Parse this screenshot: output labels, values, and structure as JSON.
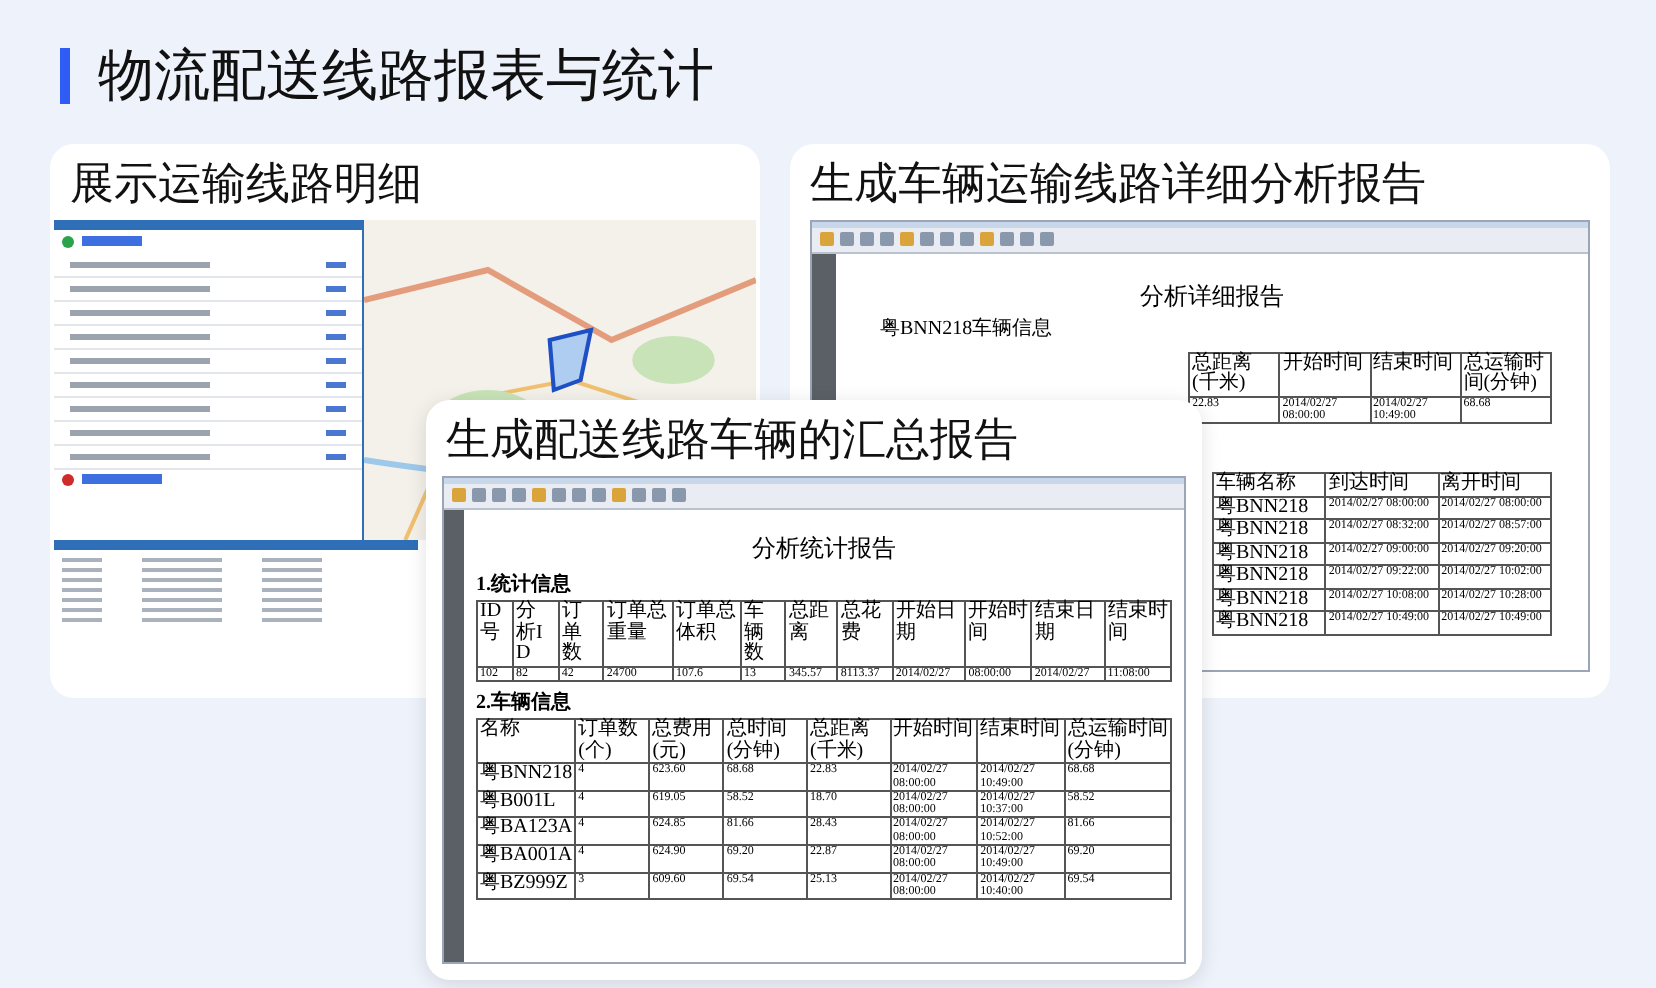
{
  "page_title": "物流配送线路报表与统计",
  "cards": [
    {
      "title": "展示运输线路明细",
      "kind": "map"
    },
    {
      "title": "生成车辆运输线路详细分析报告",
      "kind": "detail"
    },
    {
      "title": "生成配送线路车辆的汇总报告",
      "kind": "summary"
    }
  ],
  "detail_report": {
    "title": "分析详细报告",
    "subtitle": "粤BNN218车辆信息",
    "table_1": {
      "columns": [
        "总距离(千米)",
        "开始时间",
        "结束时间",
        "总运输时间(分钟)"
      ],
      "rows": [
        [
          "22.83",
          "2014/02/27 08:00:00",
          "2014/02/27 10:49:00",
          "68.68"
        ]
      ]
    },
    "table_2": {
      "columns": [
        "车辆名称",
        "到达时间",
        "离开时间"
      ],
      "rows": [
        [
          "粤BNN218",
          "2014/02/27 08:00:00",
          "2014/02/27 08:00:00"
        ],
        [
          "粤BNN218",
          "2014/02/27 08:32:00",
          "2014/02/27 08:57:00"
        ],
        [
          "粤BNN218",
          "2014/02/27 09:00:00",
          "2014/02/27 09:20:00"
        ],
        [
          "粤BNN218",
          "2014/02/27 09:22:00",
          "2014/02/27 10:02:00"
        ],
        [
          "粤BNN218",
          "2014/02/27 10:08:00",
          "2014/02/27 10:28:00"
        ],
        [
          "粤BNN218",
          "2014/02/27 10:49:00",
          "2014/02/27 10:49:00"
        ]
      ]
    }
  },
  "summary_report": {
    "title": "分析统计报告",
    "sections": [
      {
        "heading": "1.统计信息",
        "columns": [
          "ID号",
          "分析ID",
          "订单数",
          "订单总重量",
          "订单总体积",
          "车辆数",
          "总距离",
          "总花费",
          "开始日期",
          "开始时间",
          "结束日期",
          "结束时间"
        ],
        "rows": [
          [
            "102",
            "82",
            "42",
            "24700",
            "107.6",
            "13",
            "345.57",
            "8113.37",
            "2014/02/27",
            "08:00:00",
            "2014/02/27",
            "11:08:00"
          ]
        ]
      },
      {
        "heading": "2.车辆信息",
        "columns": [
          "名称",
          "订单数(个)",
          "总费用(元)",
          "总时间(分钟)",
          "总距离(千米)",
          "开始时间",
          "结束时间",
          "总运输时间(分钟)"
        ],
        "rows": [
          [
            "粤BNN218",
            "4",
            "623.60",
            "68.68",
            "22.83",
            "2014/02/27 08:00:00",
            "2014/02/27 10:49:00",
            "68.68"
          ],
          [
            "粤B001L",
            "4",
            "619.05",
            "58.52",
            "18.70",
            "2014/02/27 08:00:00",
            "2014/02/27 10:37:00",
            "58.52"
          ],
          [
            "粤BA123A",
            "4",
            "624.85",
            "81.66",
            "28.43",
            "2014/02/27 08:00:00",
            "2014/02/27 10:52:00",
            "81.66"
          ],
          [
            "粤BA001A",
            "4",
            "624.90",
            "69.20",
            "22.87",
            "2014/02/27 08:00:00",
            "2014/02/27 10:49:00",
            "69.20"
          ],
          [
            "粤BZ999Z",
            "3",
            "609.60",
            "69.54",
            "25.13",
            "2014/02/27 08:00:00",
            "2014/02/27 10:40:00",
            "69.54"
          ]
        ]
      }
    ]
  }
}
